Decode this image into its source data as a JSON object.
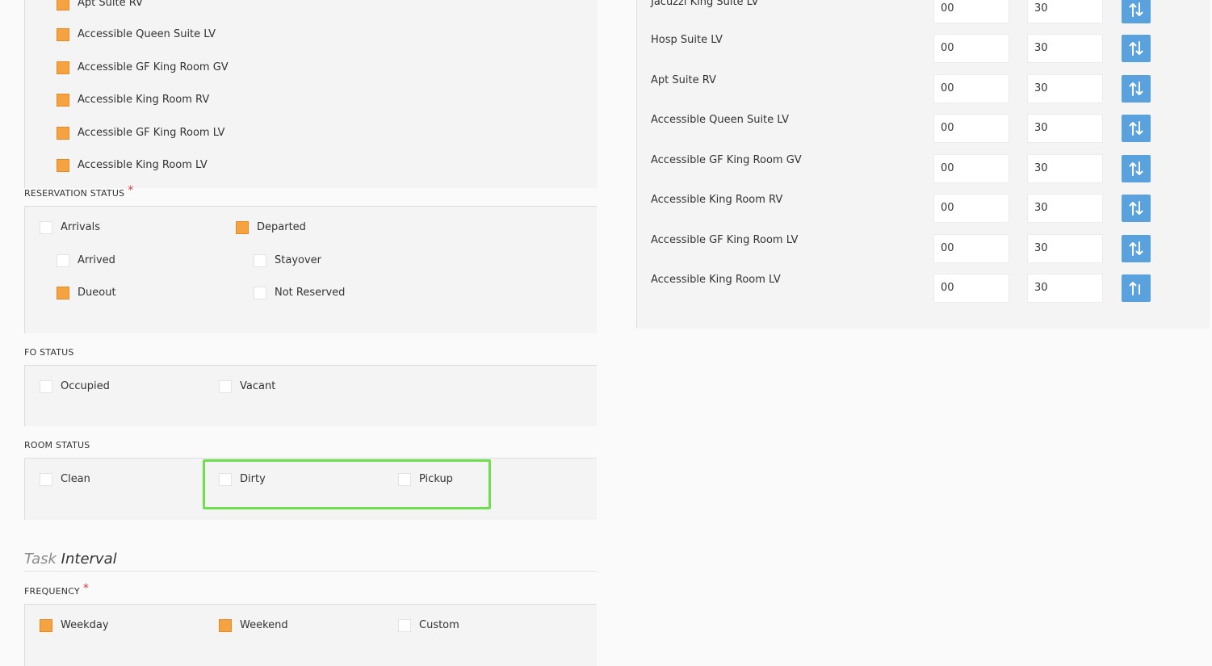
{
  "room_types_list": [
    {
      "label": "Apt Suite RV",
      "checked": true
    },
    {
      "label": "Accessible Queen Suite LV",
      "checked": true
    },
    {
      "label": "Accessible GF King Room GV",
      "checked": true
    },
    {
      "label": "Accessible King Room RV",
      "checked": true
    },
    {
      "label": "Accessible GF King Room LV",
      "checked": true
    },
    {
      "label": "Accessible King Room LV",
      "checked": true
    }
  ],
  "reservation_status": {
    "heading": "RESERVATION STATUS",
    "required_mark": "*",
    "arrivals": {
      "label": "Arrivals",
      "checked": false
    },
    "arrived": {
      "label": "Arrived",
      "checked": false
    },
    "dueout": {
      "label": "Dueout",
      "checked": true
    },
    "departed": {
      "label": "Departed",
      "checked": true
    },
    "stayover": {
      "label": "Stayover",
      "checked": false
    },
    "not_reserved": {
      "label": "Not Reserved",
      "checked": false
    }
  },
  "fo_status": {
    "heading": "FO STATUS",
    "occupied": {
      "label": "Occupied",
      "checked": false
    },
    "vacant": {
      "label": "Vacant",
      "checked": false
    }
  },
  "room_status": {
    "heading": "ROOM STATUS",
    "clean": {
      "label": "Clean",
      "checked": false
    },
    "dirty": {
      "label": "Dirty",
      "checked": false
    },
    "pickup": {
      "label": "Pickup",
      "checked": false
    }
  },
  "task_interval": {
    "title_part1": "Task",
    "title_part2": "Interval"
  },
  "frequency": {
    "heading": "FREQUENCY",
    "required_mark": "*",
    "weekday": {
      "label": "Weekday",
      "checked": true
    },
    "weekend": {
      "label": "Weekend",
      "checked": true
    },
    "custom": {
      "label": "Custom",
      "checked": false
    }
  },
  "room_order_rows": [
    {
      "label": "Jacuzzi King Suite LV",
      "first": "00",
      "second": "30"
    },
    {
      "label": "Hosp Suite LV",
      "first": "00",
      "second": "30"
    },
    {
      "label": "Apt Suite RV",
      "first": "00",
      "second": "30"
    },
    {
      "label": "Accessible Queen Suite LV",
      "first": "00",
      "second": "30"
    },
    {
      "label": "Accessible GF King Room GV",
      "first": "00",
      "second": "30"
    },
    {
      "label": "Accessible King Room RV",
      "first": "00",
      "second": "30"
    },
    {
      "label": "Accessible GF King Room LV",
      "first": "00",
      "second": "30"
    },
    {
      "label": "Accessible King Room LV",
      "first": "00",
      "second": "30"
    }
  ],
  "icons": {
    "sort": "sort-up-down-icon",
    "sort_up": "sort-up-icon"
  },
  "colors": {
    "checked": "#f4a340",
    "sort_button": "#5aa2dd",
    "highlight": "#6ee04f",
    "required": "#e03b3b"
  }
}
